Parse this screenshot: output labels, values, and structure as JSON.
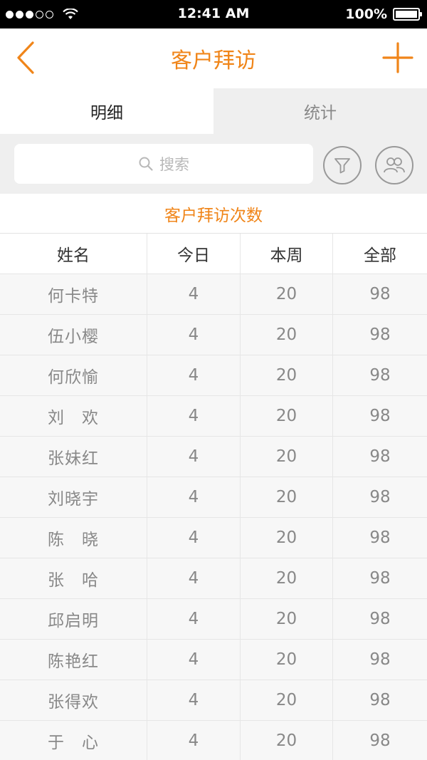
{
  "status_bar": {
    "time": "12:41 AM",
    "battery": "100%"
  },
  "nav": {
    "title": "客户拜访"
  },
  "tabs": [
    {
      "label": "明细",
      "active": true
    },
    {
      "label": "统计",
      "active": false
    }
  ],
  "search": {
    "placeholder": "搜索"
  },
  "section_title": "客户拜访次数",
  "table": {
    "headers": [
      "姓名",
      "今日",
      "本周",
      "全部"
    ],
    "rows": [
      [
        "何卡特",
        "4",
        "20",
        "98"
      ],
      [
        "伍小樱",
        "4",
        "20",
        "98"
      ],
      [
        "何欣愉",
        "4",
        "20",
        "98"
      ],
      [
        "刘　欢",
        "4",
        "20",
        "98"
      ],
      [
        "张妹红",
        "4",
        "20",
        "98"
      ],
      [
        "刘晓宇",
        "4",
        "20",
        "98"
      ],
      [
        "陈　晓",
        "4",
        "20",
        "98"
      ],
      [
        "张　哈",
        "4",
        "20",
        "98"
      ],
      [
        "邱启明",
        "4",
        "20",
        "98"
      ],
      [
        "陈艳红",
        "4",
        "20",
        "98"
      ],
      [
        "张得欢",
        "4",
        "20",
        "98"
      ],
      [
        "于　心",
        "4",
        "20",
        "98"
      ]
    ]
  },
  "colors": {
    "accent": "#f08519",
    "tab_inactive_bg": "#efefef",
    "row_bg": "#f7f7f7"
  },
  "icons": {
    "back": "chevron-left-icon",
    "add": "plus-icon",
    "search": "search-icon",
    "filter": "filter-icon",
    "people": "people-icon"
  }
}
